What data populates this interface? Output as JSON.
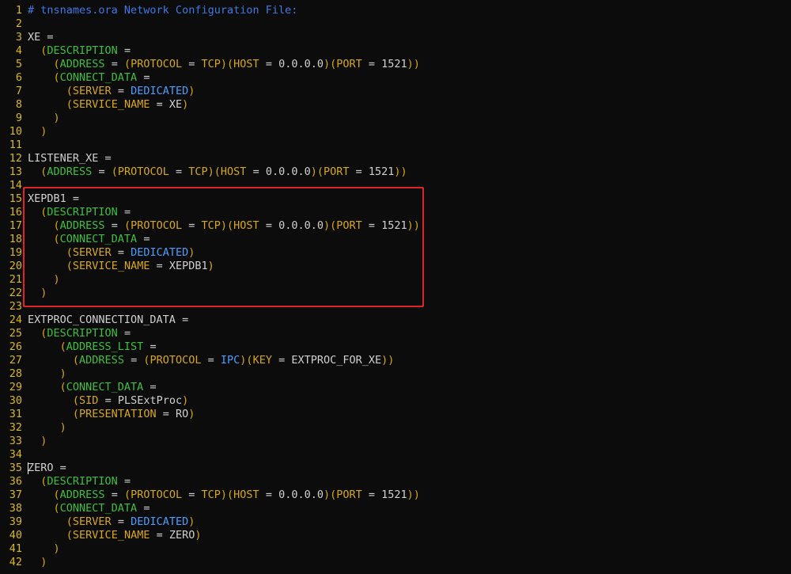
{
  "colors": {
    "background": "#0c0c0c",
    "line_number": "#d7b81e",
    "comment": "#3f78e6",
    "keyword_green": "#3fbf3f",
    "keyword_yellow": "#d7a814",
    "keyword_blue": "#4a9eff",
    "plain": "#d0d0d0",
    "highlight": "#e02424"
  },
  "editor": {
    "lines": [
      {
        "n": "1",
        "tokens": [
          [
            "comment",
            "# tnsnames.ora Network Configuration File:"
          ]
        ]
      },
      {
        "n": "2",
        "tokens": []
      },
      {
        "n": "3",
        "tokens": [
          [
            "plain",
            "XE ="
          ]
        ]
      },
      {
        "n": "4",
        "tokens": [
          [
            "plain",
            "  "
          ],
          [
            "punc",
            "("
          ],
          [
            "green",
            "DESCRIPTION"
          ],
          [
            "plain",
            " ="
          ]
        ]
      },
      {
        "n": "5",
        "tokens": [
          [
            "plain",
            "    "
          ],
          [
            "punc",
            "("
          ],
          [
            "green",
            "ADDRESS"
          ],
          [
            "plain",
            " = "
          ],
          [
            "punc",
            "("
          ],
          [
            "yellow",
            "PROTOCOL"
          ],
          [
            "plain",
            " = "
          ],
          [
            "yellow",
            "TCP"
          ],
          [
            "punc",
            ")("
          ],
          [
            "yellow",
            "HOST"
          ],
          [
            "plain",
            " = 0.0.0.0"
          ],
          [
            "punc",
            ")("
          ],
          [
            "yellow",
            "PORT"
          ],
          [
            "plain",
            " = 1521"
          ],
          [
            "punc",
            "))"
          ]
        ]
      },
      {
        "n": "6",
        "tokens": [
          [
            "plain",
            "    "
          ],
          [
            "punc",
            "("
          ],
          [
            "green",
            "CONNECT_DATA"
          ],
          [
            "plain",
            " ="
          ]
        ]
      },
      {
        "n": "7",
        "tokens": [
          [
            "plain",
            "      "
          ],
          [
            "punc",
            "("
          ],
          [
            "yellow",
            "SERVER"
          ],
          [
            "plain",
            " = "
          ],
          [
            "blue",
            "DEDICATED"
          ],
          [
            "punc",
            ")"
          ]
        ]
      },
      {
        "n": "8",
        "tokens": [
          [
            "plain",
            "      "
          ],
          [
            "punc",
            "("
          ],
          [
            "yellow",
            "SERVICE_NAME"
          ],
          [
            "plain",
            " = XE"
          ],
          [
            "punc",
            ")"
          ]
        ]
      },
      {
        "n": "9",
        "tokens": [
          [
            "plain",
            "    "
          ],
          [
            "punc",
            ")"
          ]
        ]
      },
      {
        "n": "10",
        "tokens": [
          [
            "plain",
            "  "
          ],
          [
            "punc",
            ")"
          ]
        ]
      },
      {
        "n": "11",
        "tokens": []
      },
      {
        "n": "12",
        "tokens": [
          [
            "plain",
            "LISTENER_XE ="
          ]
        ]
      },
      {
        "n": "13",
        "tokens": [
          [
            "plain",
            "  "
          ],
          [
            "punc",
            "("
          ],
          [
            "green",
            "ADDRESS"
          ],
          [
            "plain",
            " = "
          ],
          [
            "punc",
            "("
          ],
          [
            "yellow",
            "PROTOCOL"
          ],
          [
            "plain",
            " = "
          ],
          [
            "yellow",
            "TCP"
          ],
          [
            "punc",
            ")("
          ],
          [
            "yellow",
            "HOST"
          ],
          [
            "plain",
            " = 0.0.0.0"
          ],
          [
            "punc",
            ")("
          ],
          [
            "yellow",
            "PORT"
          ],
          [
            "plain",
            " = 1521"
          ],
          [
            "punc",
            "))"
          ]
        ]
      },
      {
        "n": "14",
        "tokens": []
      },
      {
        "n": "15",
        "tokens": [
          [
            "plain",
            "XEPDB1 ="
          ]
        ]
      },
      {
        "n": "16",
        "tokens": [
          [
            "plain",
            "  "
          ],
          [
            "punc",
            "("
          ],
          [
            "green",
            "DESCRIPTION"
          ],
          [
            "plain",
            " ="
          ]
        ]
      },
      {
        "n": "17",
        "tokens": [
          [
            "plain",
            "    "
          ],
          [
            "punc",
            "("
          ],
          [
            "green",
            "ADDRESS"
          ],
          [
            "plain",
            " = "
          ],
          [
            "punc",
            "("
          ],
          [
            "yellow",
            "PROTOCOL"
          ],
          [
            "plain",
            " = "
          ],
          [
            "yellow",
            "TCP"
          ],
          [
            "punc",
            ")("
          ],
          [
            "yellow",
            "HOST"
          ],
          [
            "plain",
            " = 0.0.0.0"
          ],
          [
            "punc",
            ")("
          ],
          [
            "yellow",
            "PORT"
          ],
          [
            "plain",
            " = 1521"
          ],
          [
            "punc",
            "))"
          ]
        ]
      },
      {
        "n": "18",
        "tokens": [
          [
            "plain",
            "    "
          ],
          [
            "punc",
            "("
          ],
          [
            "green",
            "CONNECT_DATA"
          ],
          [
            "plain",
            " ="
          ]
        ]
      },
      {
        "n": "19",
        "tokens": [
          [
            "plain",
            "      "
          ],
          [
            "punc",
            "("
          ],
          [
            "yellow",
            "SERVER"
          ],
          [
            "plain",
            " = "
          ],
          [
            "blue",
            "DEDICATED"
          ],
          [
            "punc",
            ")"
          ]
        ]
      },
      {
        "n": "20",
        "tokens": [
          [
            "plain",
            "      "
          ],
          [
            "punc",
            "("
          ],
          [
            "yellow",
            "SERVICE_NAME"
          ],
          [
            "plain",
            " = XEPDB1"
          ],
          [
            "punc",
            ")"
          ]
        ]
      },
      {
        "n": "21",
        "tokens": [
          [
            "plain",
            "    "
          ],
          [
            "punc",
            ")"
          ]
        ]
      },
      {
        "n": "22",
        "tokens": [
          [
            "plain",
            "  "
          ],
          [
            "punc",
            ")"
          ]
        ]
      },
      {
        "n": "23",
        "tokens": []
      },
      {
        "n": "24",
        "tokens": [
          [
            "plain",
            "EXTPROC_CONNECTION_DATA ="
          ]
        ]
      },
      {
        "n": "25",
        "tokens": [
          [
            "plain",
            "  "
          ],
          [
            "punc",
            "("
          ],
          [
            "green",
            "DESCRIPTION"
          ],
          [
            "plain",
            " ="
          ]
        ]
      },
      {
        "n": "26",
        "tokens": [
          [
            "plain",
            "     "
          ],
          [
            "punc",
            "("
          ],
          [
            "green",
            "ADDRESS_LIST"
          ],
          [
            "plain",
            " ="
          ]
        ]
      },
      {
        "n": "27",
        "tokens": [
          [
            "plain",
            "       "
          ],
          [
            "punc",
            "("
          ],
          [
            "green",
            "ADDRESS"
          ],
          [
            "plain",
            " = "
          ],
          [
            "punc",
            "("
          ],
          [
            "yellow",
            "PROTOCOL"
          ],
          [
            "plain",
            " = "
          ],
          [
            "blue",
            "IPC"
          ],
          [
            "punc",
            ")("
          ],
          [
            "yellow",
            "KEY"
          ],
          [
            "plain",
            " = EXTPROC_FOR_XE"
          ],
          [
            "punc",
            "))"
          ]
        ]
      },
      {
        "n": "28",
        "tokens": [
          [
            "plain",
            "     "
          ],
          [
            "punc",
            ")"
          ]
        ]
      },
      {
        "n": "29",
        "tokens": [
          [
            "plain",
            "     "
          ],
          [
            "punc",
            "("
          ],
          [
            "green",
            "CONNECT_DATA"
          ],
          [
            "plain",
            " ="
          ]
        ]
      },
      {
        "n": "30",
        "tokens": [
          [
            "plain",
            "       "
          ],
          [
            "punc",
            "("
          ],
          [
            "yellow",
            "SID"
          ],
          [
            "plain",
            " = PLSExtProc"
          ],
          [
            "punc",
            ")"
          ]
        ]
      },
      {
        "n": "31",
        "tokens": [
          [
            "plain",
            "       "
          ],
          [
            "punc",
            "("
          ],
          [
            "yellow",
            "PRESENTATION"
          ],
          [
            "plain",
            " = RO"
          ],
          [
            "punc",
            ")"
          ]
        ]
      },
      {
        "n": "32",
        "tokens": [
          [
            "plain",
            "     "
          ],
          [
            "punc",
            ")"
          ]
        ]
      },
      {
        "n": "33",
        "tokens": [
          [
            "plain",
            "  "
          ],
          [
            "punc",
            ")"
          ]
        ]
      },
      {
        "n": "34",
        "tokens": []
      },
      {
        "n": "35",
        "tokens": [
          [
            "cursor",
            ""
          ],
          [
            "plain",
            "ZERO ="
          ]
        ]
      },
      {
        "n": "36",
        "tokens": [
          [
            "plain",
            "  "
          ],
          [
            "punc",
            "("
          ],
          [
            "green",
            "DESCRIPTION"
          ],
          [
            "plain",
            " ="
          ]
        ]
      },
      {
        "n": "37",
        "tokens": [
          [
            "plain",
            "    "
          ],
          [
            "punc",
            "("
          ],
          [
            "green",
            "ADDRESS"
          ],
          [
            "plain",
            " = "
          ],
          [
            "punc",
            "("
          ],
          [
            "yellow",
            "PROTOCOL"
          ],
          [
            "plain",
            " = "
          ],
          [
            "yellow",
            "TCP"
          ],
          [
            "punc",
            ")("
          ],
          [
            "yellow",
            "HOST"
          ],
          [
            "plain",
            " = 0.0.0.0"
          ],
          [
            "punc",
            ")("
          ],
          [
            "yellow",
            "PORT"
          ],
          [
            "plain",
            " = 1521"
          ],
          [
            "punc",
            "))"
          ]
        ]
      },
      {
        "n": "38",
        "tokens": [
          [
            "plain",
            "    "
          ],
          [
            "punc",
            "("
          ],
          [
            "green",
            "CONNECT_DATA"
          ],
          [
            "plain",
            " ="
          ]
        ]
      },
      {
        "n": "39",
        "tokens": [
          [
            "plain",
            "      "
          ],
          [
            "punc",
            "("
          ],
          [
            "yellow",
            "SERVER"
          ],
          [
            "plain",
            " = "
          ],
          [
            "blue",
            "DEDICATED"
          ],
          [
            "punc",
            ")"
          ]
        ]
      },
      {
        "n": "40",
        "tokens": [
          [
            "plain",
            "      "
          ],
          [
            "punc",
            "("
          ],
          [
            "yellow",
            "SERVICE_NAME"
          ],
          [
            "plain",
            " = ZERO"
          ],
          [
            "punc",
            ")"
          ]
        ]
      },
      {
        "n": "41",
        "tokens": [
          [
            "plain",
            "    "
          ],
          [
            "punc",
            ")"
          ]
        ]
      },
      {
        "n": "42",
        "tokens": [
          [
            "plain",
            "  "
          ],
          [
            "punc",
            ")"
          ]
        ]
      }
    ]
  }
}
